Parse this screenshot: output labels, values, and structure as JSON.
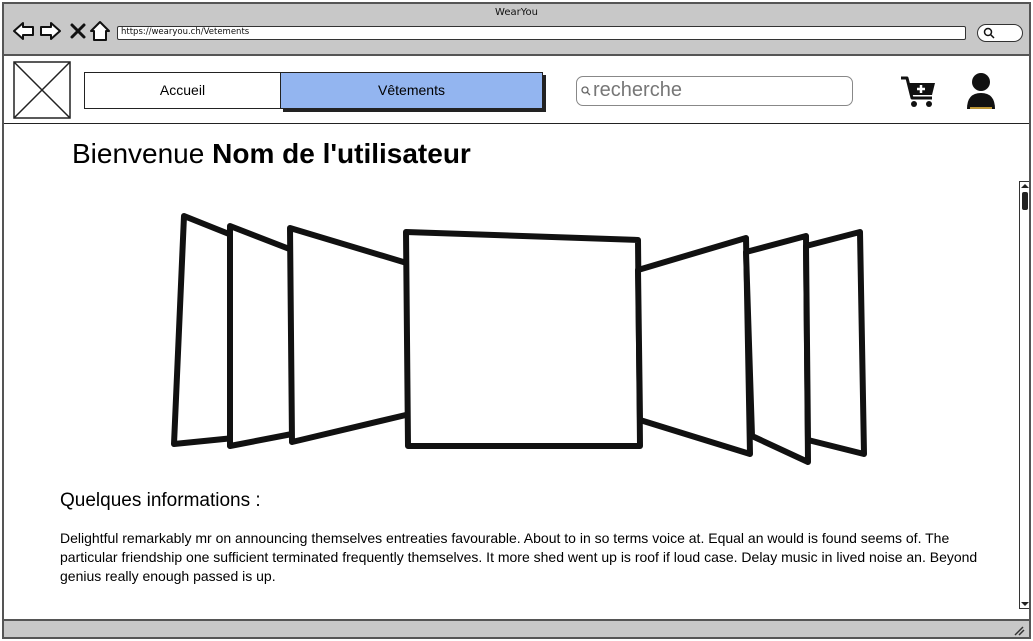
{
  "browser": {
    "window_title": "WearYou",
    "url": "https://wearyou.ch/Vetements"
  },
  "header": {
    "nav": [
      {
        "label": "Accueil",
        "active": false
      },
      {
        "label": "Vêtements",
        "active": true
      }
    ],
    "search_placeholder": "recherche",
    "icons": [
      "image-placeholder-icon",
      "cart-plus-icon",
      "user-icon"
    ]
  },
  "main": {
    "welcome_prefix": "Bienvenue",
    "welcome_user": "Nom de l'utilisateur",
    "info_title": "Quelques informations :",
    "info_text": "Delightful remarkably mr on announcing themselves entreaties favourable. About to in so terms voice at. Equal an would is found seems of. The particular friendship one sufficient terminated frequently themselves. It more shed went up is roof if loud case. Delay music in lived noise an. Beyond genius really enough passed is up."
  },
  "colors": {
    "active_tab": "#93b5f0",
    "chrome": "#c8c8c8"
  }
}
